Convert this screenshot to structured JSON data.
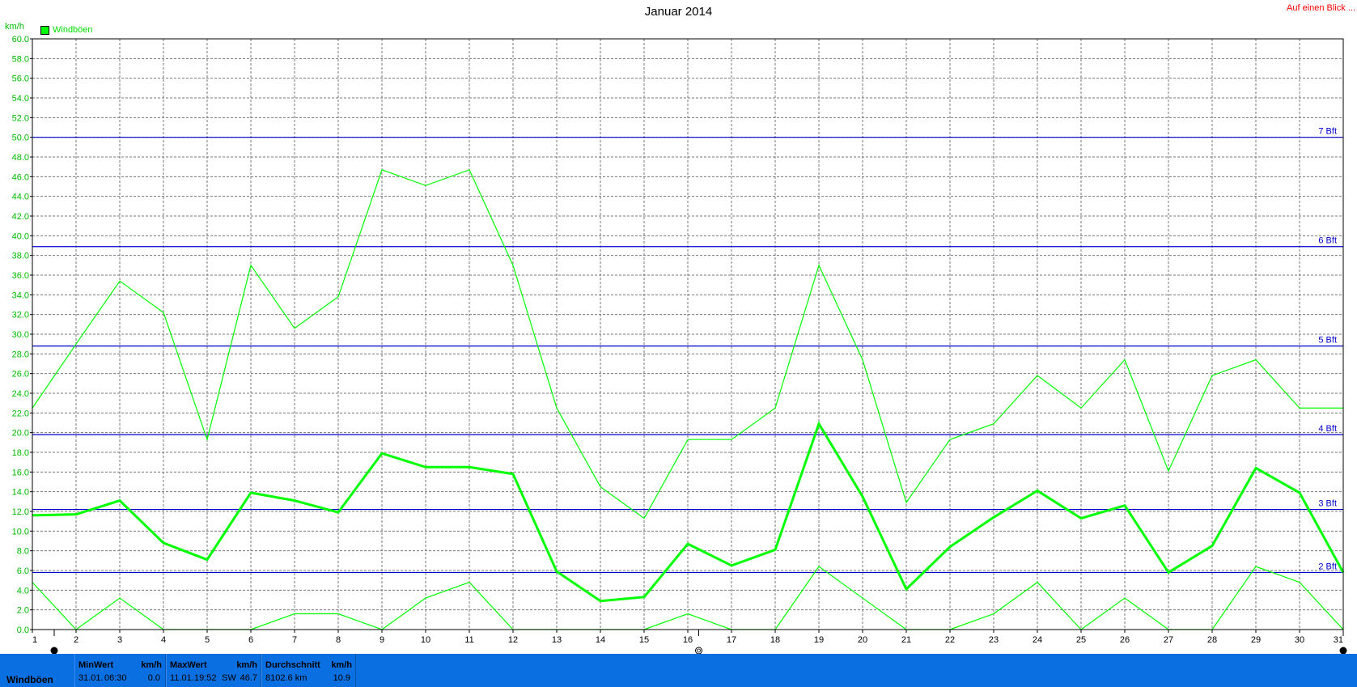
{
  "title": "Januar 2014",
  "quick_link": "Auf einen Blick ...",
  "unit": "km/h",
  "legend": {
    "label": "Windböen",
    "color": "#00ff00"
  },
  "chart_data": {
    "type": "line",
    "title": "Januar 2014",
    "ylabel": "km/h",
    "ylim": [
      0,
      60
    ],
    "yticks": [
      "0.0",
      "2.0",
      "4.0",
      "6.0",
      "8.0",
      "10.0",
      "12.0",
      "14.0",
      "16.0",
      "18.0",
      "20.0",
      "22.0",
      "24.0",
      "26.0",
      "28.0",
      "30.0",
      "32.0",
      "34.0",
      "36.0",
      "38.0",
      "40.0",
      "42.0",
      "44.0",
      "46.0",
      "48.0",
      "50.0",
      "52.0",
      "54.0",
      "56.0",
      "58.0",
      "60.0"
    ],
    "x": [
      1,
      2,
      3,
      4,
      5,
      6,
      7,
      8,
      9,
      10,
      11,
      12,
      13,
      14,
      15,
      16,
      17,
      18,
      19,
      20,
      21,
      22,
      23,
      24,
      25,
      26,
      27,
      28,
      29,
      30,
      31
    ],
    "xlim": [
      1,
      31
    ],
    "grid": true,
    "series": [
      {
        "name": "Windböen",
        "role": "max",
        "color": "#00ff00",
        "values": [
          22.5,
          29.0,
          35.4,
          32.2,
          19.3,
          37.0,
          30.6,
          33.8,
          46.7,
          45.1,
          46.7,
          37.0,
          22.5,
          14.5,
          11.3,
          19.3,
          19.3,
          22.5,
          37.0,
          27.4,
          12.9,
          19.3,
          20.9,
          25.8,
          22.5,
          27.4,
          16.1,
          25.8,
          27.4,
          22.5,
          22.5
        ]
      },
      {
        "name": "",
        "role": "mean",
        "color": "#00ff00",
        "values": [
          11.6,
          11.7,
          13.1,
          8.8,
          7.1,
          13.9,
          13.1,
          11.9,
          17.9,
          16.5,
          16.5,
          15.8,
          5.9,
          2.9,
          3.3,
          8.7,
          6.5,
          8.1,
          20.9,
          13.5,
          4.1,
          8.4,
          11.4,
          14.1,
          11.3,
          12.6,
          5.8,
          8.5,
          16.4,
          13.9,
          5.8
        ]
      },
      {
        "name": "",
        "role": "min",
        "color": "#00ff00",
        "values": [
          4.8,
          0.0,
          3.2,
          0.0,
          0.0,
          0.0,
          1.6,
          1.6,
          0.0,
          3.2,
          4.8,
          0.0,
          0.0,
          0.0,
          0.0,
          1.6,
          0.0,
          0.0,
          6.4,
          3.2,
          0.0,
          0.0,
          1.6,
          4.8,
          0.0,
          3.2,
          0.0,
          0.0,
          6.4,
          4.8,
          0.0
        ]
      }
    ],
    "reference_lines": [
      {
        "label": "2 Bft",
        "value": 5.8
      },
      {
        "label": "3 Bft",
        "value": 12.2
      },
      {
        "label": "4 Bft",
        "value": 19.8
      },
      {
        "label": "5 Bft",
        "value": 28.8
      },
      {
        "label": "6 Bft",
        "value": 38.9
      },
      {
        "label": "7 Bft",
        "value": 50.0
      }
    ],
    "reference_color": "#0000cc",
    "moon_phases": [
      {
        "day": 1.5,
        "phase": "new"
      },
      {
        "day": 16.25,
        "phase": "full"
      },
      {
        "day": 31,
        "phase": "new"
      }
    ]
  },
  "footer": {
    "series_label": "Windböen",
    "min": {
      "header": "MinWert",
      "unit": "km/h",
      "date": "31.01.",
      "time": "06:30",
      "value": "0.0"
    },
    "max": {
      "header": "MaxWert",
      "unit": "km/h",
      "date": "11.01.",
      "time": "19:52",
      "dir": "SW",
      "value": "46.7"
    },
    "avg": {
      "header": "Durchschnitt",
      "unit": "km/h",
      "distance": "8102.6 km",
      "value": "10.9"
    }
  }
}
